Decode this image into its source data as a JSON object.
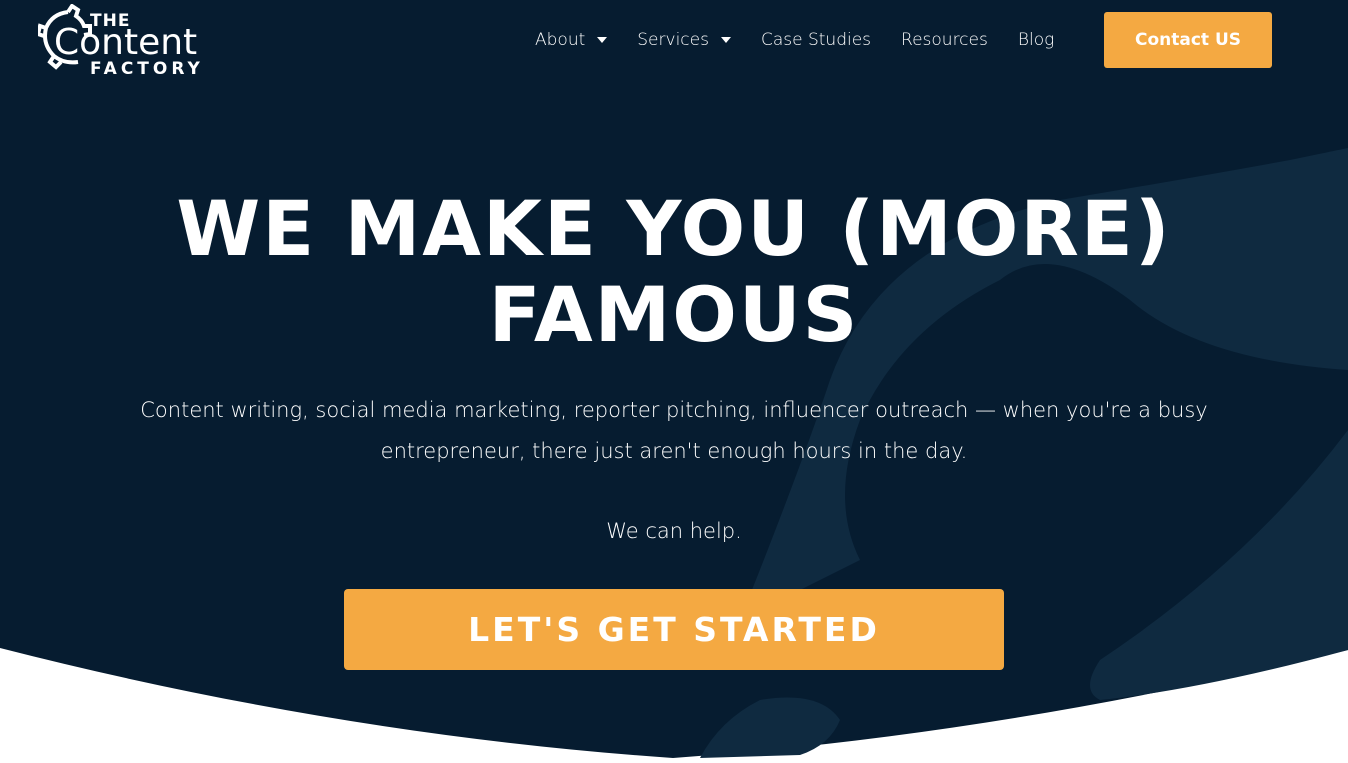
{
  "brand": {
    "logo_line1": "THE",
    "logo_line2": "Content",
    "logo_line3": "FACTORY",
    "logo_icon": "gear-icon"
  },
  "nav": {
    "items": [
      {
        "label": "About",
        "has_dropdown": true
      },
      {
        "label": "Services",
        "has_dropdown": true
      },
      {
        "label": "Case Studies",
        "has_dropdown": false
      },
      {
        "label": "Resources",
        "has_dropdown": false
      },
      {
        "label": "Blog",
        "has_dropdown": false
      }
    ],
    "contact_label": "Contact US"
  },
  "hero": {
    "headline_line1": "WE MAKE YOU (MORE)",
    "headline_line2": "FAMOUS",
    "subtext": "Content writing, social media marketing, reporter pitching, influencer outreach — when you're a busy entrepreneur, there just aren't enough hours in the day.",
    "help_text": "We can help.",
    "cta_label": "LET'S GET STARTED"
  },
  "colors": {
    "background": "#061c30",
    "accent": "#f4a942",
    "text": "#ffffff",
    "gear_shape": "#0f2a40"
  }
}
